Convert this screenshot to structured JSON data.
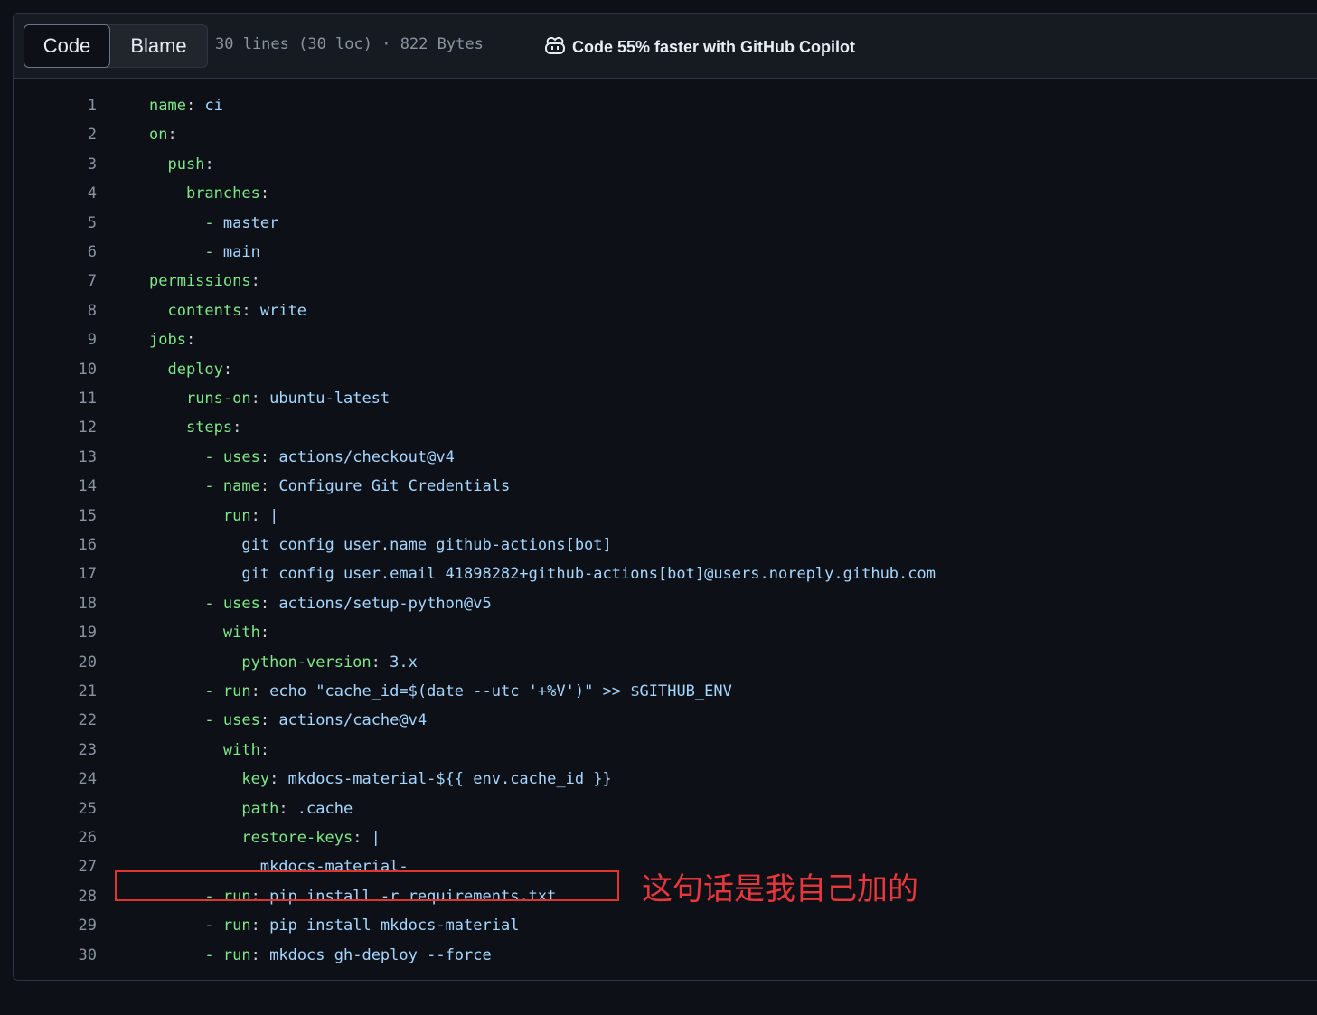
{
  "tabs": {
    "code_label": "Code",
    "blame_label": "Blame"
  },
  "file_info": "30 lines (30 loc) · 822 Bytes",
  "copilot": {
    "label": "Code 55% faster with GitHub Copilot",
    "icon": "copilot-icon"
  },
  "colors": {
    "background": "#0d1117",
    "header_background": "#161b22",
    "key": "#7ee787",
    "value": "#a5d6ff",
    "line_number": "#8b949e",
    "annotation": "#e8363a"
  },
  "lines": [
    {
      "n": "1",
      "indent": "",
      "dash": "",
      "key": "name",
      "value": "ci"
    },
    {
      "n": "2",
      "indent": "",
      "dash": "",
      "key": "on",
      "value": ""
    },
    {
      "n": "3",
      "indent": "  ",
      "dash": "",
      "key": "push",
      "value": ""
    },
    {
      "n": "4",
      "indent": "    ",
      "dash": "",
      "key": "branches",
      "value": ""
    },
    {
      "n": "5",
      "indent": "      ",
      "dash": "- ",
      "key": "",
      "value": "master"
    },
    {
      "n": "6",
      "indent": "      ",
      "dash": "- ",
      "key": "",
      "value": "main"
    },
    {
      "n": "7",
      "indent": "",
      "dash": "",
      "key": "permissions",
      "value": ""
    },
    {
      "n": "8",
      "indent": "  ",
      "dash": "",
      "key": "contents",
      "value": "write"
    },
    {
      "n": "9",
      "indent": "",
      "dash": "",
      "key": "jobs",
      "value": ""
    },
    {
      "n": "10",
      "indent": "  ",
      "dash": "",
      "key": "deploy",
      "value": ""
    },
    {
      "n": "11",
      "indent": "    ",
      "dash": "",
      "key": "runs-on",
      "value": "ubuntu-latest"
    },
    {
      "n": "12",
      "indent": "    ",
      "dash": "",
      "key": "steps",
      "value": ""
    },
    {
      "n": "13",
      "indent": "      ",
      "dash": "- ",
      "key": "uses",
      "value": "actions/checkout@v4"
    },
    {
      "n": "14",
      "indent": "      ",
      "dash": "- ",
      "key": "name",
      "value": "Configure Git Credentials"
    },
    {
      "n": "15",
      "indent": "        ",
      "dash": "",
      "key": "run",
      "value": "|"
    },
    {
      "n": "16",
      "indent": "          ",
      "dash": "",
      "key": "",
      "value": "git config user.name github-actions[bot]"
    },
    {
      "n": "17",
      "indent": "          ",
      "dash": "",
      "key": "",
      "value": "git config user.email 41898282+github-actions[bot]@users.noreply.github.com"
    },
    {
      "n": "18",
      "indent": "      ",
      "dash": "- ",
      "key": "uses",
      "value": "actions/setup-python@v5"
    },
    {
      "n": "19",
      "indent": "        ",
      "dash": "",
      "key": "with",
      "value": ""
    },
    {
      "n": "20",
      "indent": "          ",
      "dash": "",
      "key": "python-version",
      "value": "3.x"
    },
    {
      "n": "21",
      "indent": "      ",
      "dash": "- ",
      "key": "run",
      "value": "echo \"cache_id=$(date --utc '+%V')\" >> $GITHUB_ENV"
    },
    {
      "n": "22",
      "indent": "      ",
      "dash": "- ",
      "key": "uses",
      "value": "actions/cache@v4"
    },
    {
      "n": "23",
      "indent": "        ",
      "dash": "",
      "key": "with",
      "value": ""
    },
    {
      "n": "24",
      "indent": "          ",
      "dash": "",
      "key": "key",
      "value": "mkdocs-material-${{ env.cache_id }}"
    },
    {
      "n": "25",
      "indent": "          ",
      "dash": "",
      "key": "path",
      "value": ".cache"
    },
    {
      "n": "26",
      "indent": "          ",
      "dash": "",
      "key": "restore-keys",
      "value": "|"
    },
    {
      "n": "27",
      "indent": "            ",
      "dash": "",
      "key": "",
      "value": "mkdocs-material-"
    },
    {
      "n": "28",
      "indent": "      ",
      "dash": "- ",
      "key": "run",
      "value": "pip install -r requirements.txt"
    },
    {
      "n": "29",
      "indent": "      ",
      "dash": "- ",
      "key": "run",
      "value": "pip install mkdocs-material"
    },
    {
      "n": "30",
      "indent": "      ",
      "dash": "- ",
      "key": "run",
      "value": "mkdocs gh-deploy --force"
    }
  ],
  "annotation": {
    "text": "这句话是我自己加的",
    "highlighted_line": "28"
  }
}
